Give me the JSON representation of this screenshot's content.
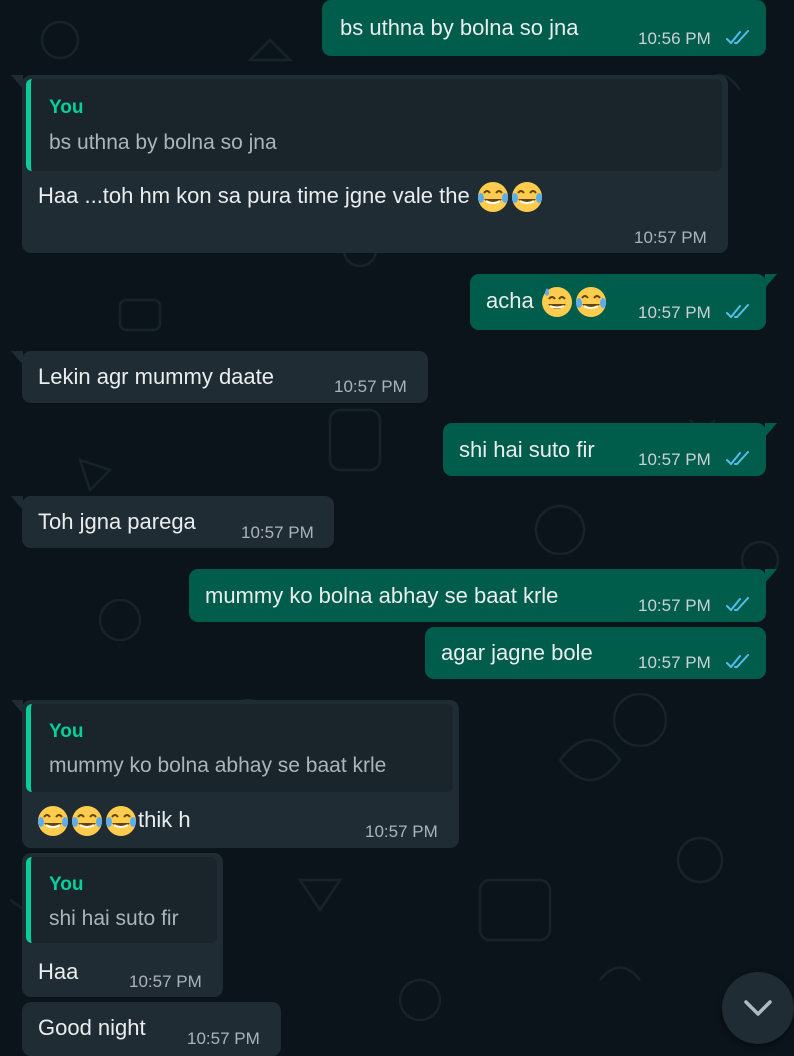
{
  "messages": [
    {
      "text": "bs uthna by bolna so jna",
      "time": "10:56 PM"
    },
    {
      "quote_author": "You",
      "quote_text": "bs uthna by bolna so jna",
      "text": "Haa ...toh hm kon sa pura time jgne vale the",
      "time": "10:57 PM"
    },
    {
      "text": "acha",
      "time": "10:57 PM"
    },
    {
      "text": "Lekin agr mummy daate",
      "time": "10:57 PM"
    },
    {
      "text": "shi hai suto fir",
      "time": "10:57 PM"
    },
    {
      "text": "Toh jgna parega",
      "time": "10:57 PM"
    },
    {
      "text": "mummy ko bolna abhay se baat krle",
      "time": "10:57 PM"
    },
    {
      "text": "agar jagne bole",
      "time": "10:57 PM"
    },
    {
      "quote_author": "You",
      "quote_text": "mummy ko bolna abhay se baat krle",
      "text": "thik h",
      "time": "10:57 PM"
    },
    {
      "quote_author": "You",
      "quote_text": "shi hai suto fir",
      "text": "Haa",
      "time": "10:57 PM"
    },
    {
      "text": "Good night",
      "time": "10:57 PM"
    }
  ],
  "icons": {
    "read_receipt": "double-check-icon",
    "laugh_emoji": "face-with-tears-of-joy",
    "grin_sweat_emoji": "grinning-face-with-sweat",
    "scroll_down": "chevron-down-icon"
  },
  "colors": {
    "outgoing_bubble": "#005c4b",
    "incoming_bubble": "#202c33",
    "background": "#0b141a",
    "quote_accent": "#06cf9c",
    "read_tick": "#53bdeb"
  }
}
